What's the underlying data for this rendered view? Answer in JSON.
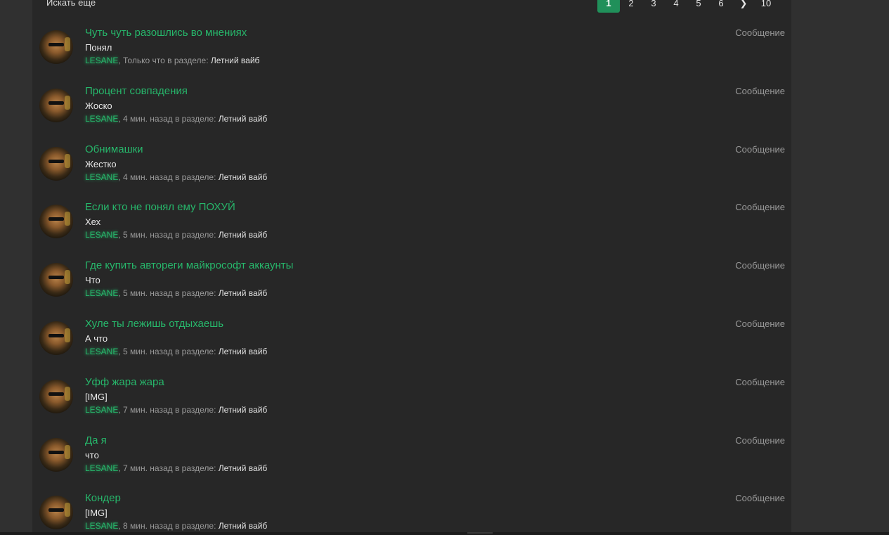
{
  "header": {
    "search_more": "Искать еще"
  },
  "pagination": {
    "pages": [
      "1",
      "2",
      "3",
      "4",
      "5",
      "6"
    ],
    "next_icon": "chevron-right-icon",
    "next_glyph": "❯",
    "last": "10",
    "active": "1"
  },
  "colors": {
    "accent": "#27b76b",
    "panel": "#272727",
    "background": "#303030"
  },
  "results": [
    {
      "title": "Чуть чуть разошлись во мнениях",
      "snippet": "Понял",
      "user": "LESANE",
      "time": "Только что",
      "in_label": " в разделе: ",
      "forum": "Летний вайб",
      "type": "Сообщение"
    },
    {
      "title": "Процент совпадения",
      "snippet": "Жоско",
      "user": "LESANE",
      "time": "4 мин. назад",
      "in_label": " в разделе: ",
      "forum": "Летний вайб",
      "type": "Сообщение"
    },
    {
      "title": "Обнимашки",
      "snippet": "Жестко",
      "user": "LESANE",
      "time": "4 мин. назад",
      "in_label": " в разделе: ",
      "forum": "Летний вайб",
      "type": "Сообщение"
    },
    {
      "title": "Если кто не понял ему ПОХУЙ",
      "snippet": "Хех",
      "user": "LESANE",
      "time": "5 мин. назад",
      "in_label": " в разделе: ",
      "forum": "Летний вайб",
      "type": "Сообщение"
    },
    {
      "title": "Где купить автореги майкрософт аккаунты",
      "snippet": "Что",
      "user": "LESANE",
      "time": "5 мин. назад",
      "in_label": " в разделе: ",
      "forum": "Летний вайб",
      "type": "Сообщение"
    },
    {
      "title": "Хуле ты лежишь отдыхаешь",
      "snippet": "А что",
      "user": "LESANE",
      "time": "5 мин. назад",
      "in_label": " в разделе: ",
      "forum": "Летний вайб",
      "type": "Сообщение"
    },
    {
      "title": "Уфф жара жара",
      "snippet": "[IMG]",
      "user": "LESANE",
      "time": "7 мин. назад",
      "in_label": " в разделе: ",
      "forum": "Летний вайб",
      "type": "Сообщение"
    },
    {
      "title": "Да я",
      "snippet": "что",
      "user": "LESANE",
      "time": "7 мин. назад",
      "in_label": " в разделе: ",
      "forum": "Летний вайб",
      "type": "Сообщение"
    },
    {
      "title": "Кондер",
      "snippet": "[IMG]",
      "user": "LESANE",
      "time": "8 мин. назад",
      "in_label": " в разделе: ",
      "forum": "Летний вайб",
      "type": "Сообщение"
    }
  ]
}
